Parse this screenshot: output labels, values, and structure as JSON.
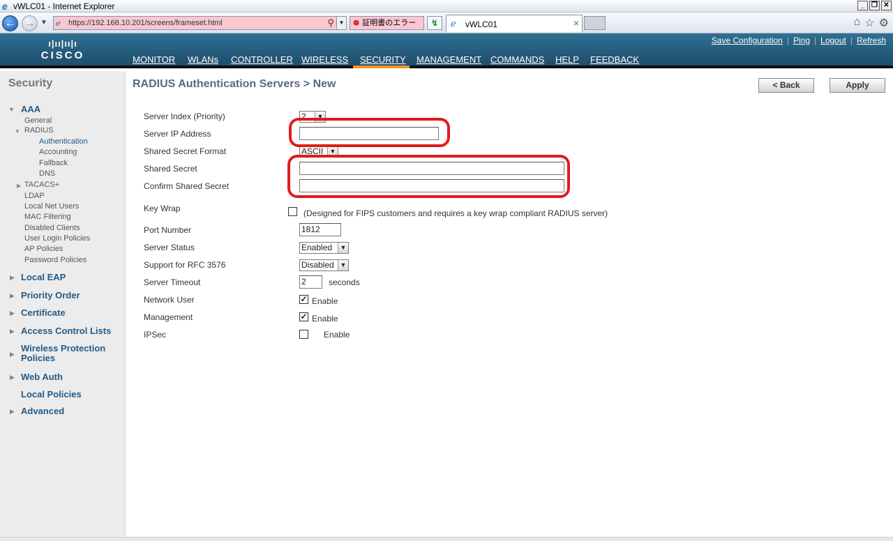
{
  "browser": {
    "window_title": "vWLC01 - Internet Explorer",
    "url_host": "https://192.168.10.201",
    "url_path": "/screens/frameset.html",
    "cert_error": "証明書のエラー",
    "tab_title": "vWLC01"
  },
  "header": {
    "logo_text": "CISCO",
    "menu": [
      "MONITOR",
      "WLANs",
      "CONTROLLER",
      "WIRELESS",
      "SECURITY",
      "MANAGEMENT",
      "COMMANDS",
      "HELP",
      "FEEDBACK"
    ],
    "active_menu": "SECURITY",
    "links": [
      "Save Configuration",
      "Ping",
      "Logout",
      "Refresh"
    ]
  },
  "sidebar": {
    "section_title": "Security",
    "aaa": "AAA",
    "general": "General",
    "radius": "RADIUS",
    "radius_items": [
      "Authentication",
      "Accounting",
      "Fallback",
      "DNS"
    ],
    "tacacs": "TACACS+",
    "aaa_items": [
      "LDAP",
      "Local Net Users",
      "MAC Filtering",
      "Disabled Clients",
      "User Login Policies",
      "AP Policies",
      "Password Policies"
    ],
    "main_items": [
      "Local EAP",
      "Priority Order",
      "Certificate",
      "Access Control Lists",
      "Wireless Protection Policies",
      "Web Auth",
      "Local Policies",
      "Advanced"
    ]
  },
  "page": {
    "title": "RADIUS Authentication Servers > New",
    "back_label": "< Back",
    "apply_label": "Apply"
  },
  "form": {
    "server_index_label": "Server Index (Priority)",
    "server_index_value": "2",
    "server_ip_label": "Server IP Address",
    "server_ip_value": "",
    "secret_format_label": "Shared Secret Format",
    "secret_format_value": "ASCII",
    "shared_secret_label": "Shared Secret",
    "shared_secret_value": "",
    "confirm_secret_label": "Confirm Shared Secret",
    "confirm_secret_value": "",
    "key_wrap_label": "Key Wrap",
    "key_wrap_checked": false,
    "key_wrap_note": "(Designed for FIPS customers and requires a key wrap compliant RADIUS server)",
    "port_label": "Port Number",
    "port_value": "1812",
    "server_status_label": "Server Status",
    "server_status_value": "Enabled",
    "rfc_label": "Support for RFC 3576",
    "rfc_value": "Disabled",
    "timeout_label": "Server Timeout",
    "timeout_value": "2",
    "timeout_unit": "seconds",
    "network_user_label": "Network User",
    "network_user_checked": true,
    "management_label": "Management",
    "management_checked": true,
    "ipsec_label": "IPSec",
    "ipsec_checked": false,
    "enable_text": "Enable"
  },
  "colors": {
    "header_blue": "#2f6f91",
    "active_tab_underline": "#f59620",
    "annotation_red": "#e01b1b",
    "sidebar_link": "#245a86"
  }
}
